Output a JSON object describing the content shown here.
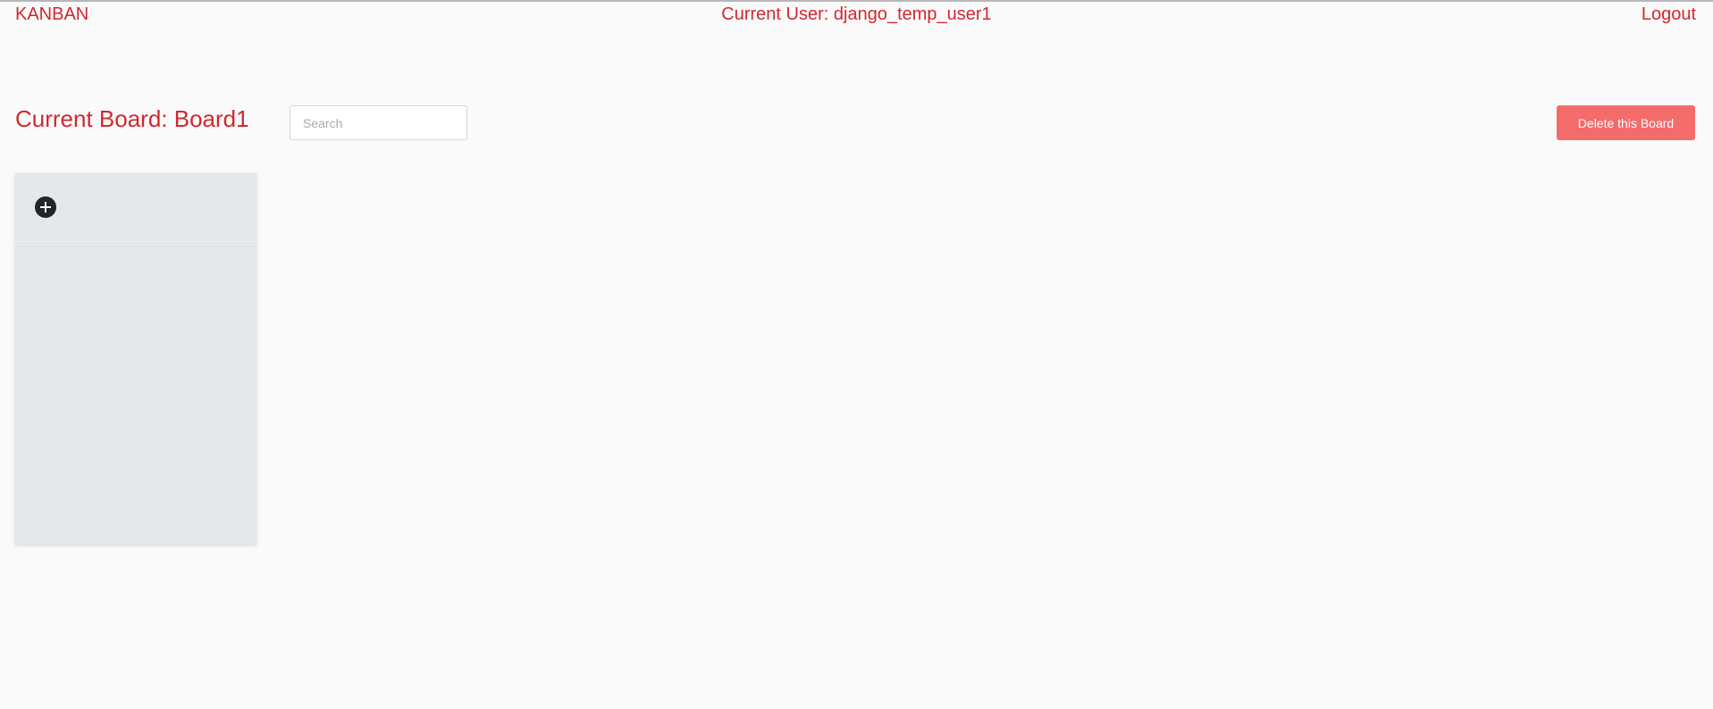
{
  "nav": {
    "brand": "KANBAN",
    "current_user": "Current User: django_temp_user1",
    "logout": "Logout"
  },
  "board": {
    "title": "Current Board: Board1",
    "search_placeholder": "Search",
    "search_value": "",
    "delete_label": "Delete this Board"
  },
  "columns": [
    {
      "add_icon": "plus-circle-icon",
      "cards": []
    }
  ],
  "colors": {
    "accent": "#d2282e",
    "delete_button": "#f36b6b",
    "column_bg": "#e5e8eb",
    "page_bg": "#fafafa"
  }
}
